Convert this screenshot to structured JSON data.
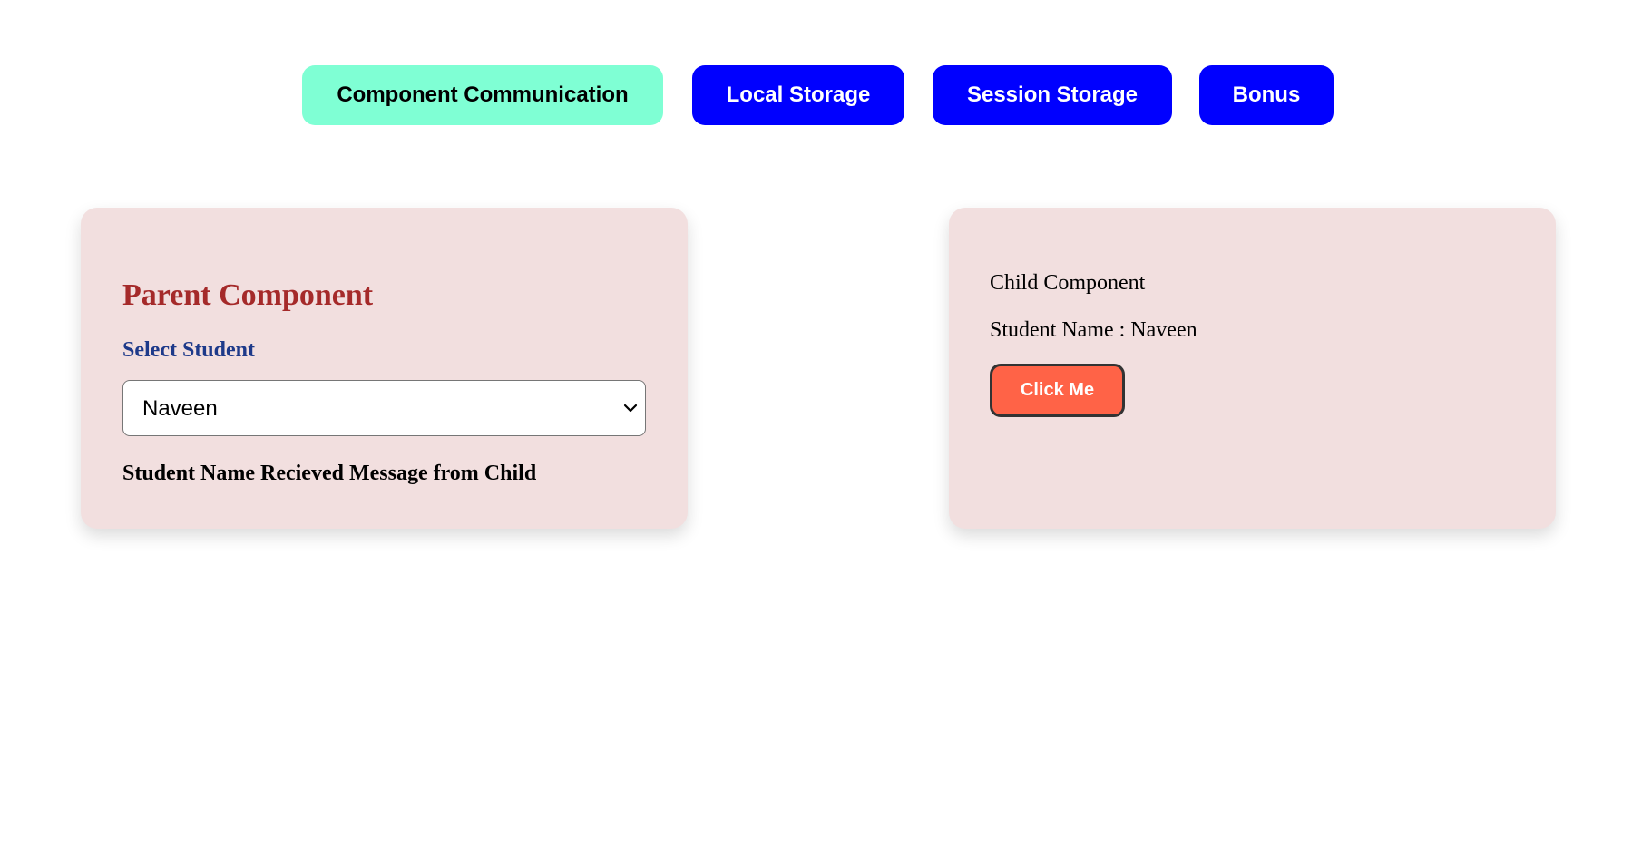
{
  "nav": {
    "tabs": [
      {
        "label": "Component Communication",
        "active": true
      },
      {
        "label": "Local Storage",
        "active": false
      },
      {
        "label": "Session Storage",
        "active": false
      },
      {
        "label": "Bonus",
        "active": false
      }
    ]
  },
  "parent": {
    "title": "Parent Component",
    "select_label": "Select Student",
    "selected_student": "Naveen",
    "received_message": "Student Name Recieved Message from Child"
  },
  "child": {
    "title": "Child Component",
    "student_name": "Student Name : Naveen",
    "button_label": "Click Me"
  },
  "colors": {
    "active_tab_bg": "#7fffd4",
    "inactive_tab_bg": "#0000ff",
    "card_bg": "#f2dfdf",
    "parent_title": "#a52a2a",
    "select_label": "#1e3a8a",
    "click_button_bg": "#ff6347"
  },
  "icons": {
    "select_chevron": "chevron-down-icon"
  }
}
